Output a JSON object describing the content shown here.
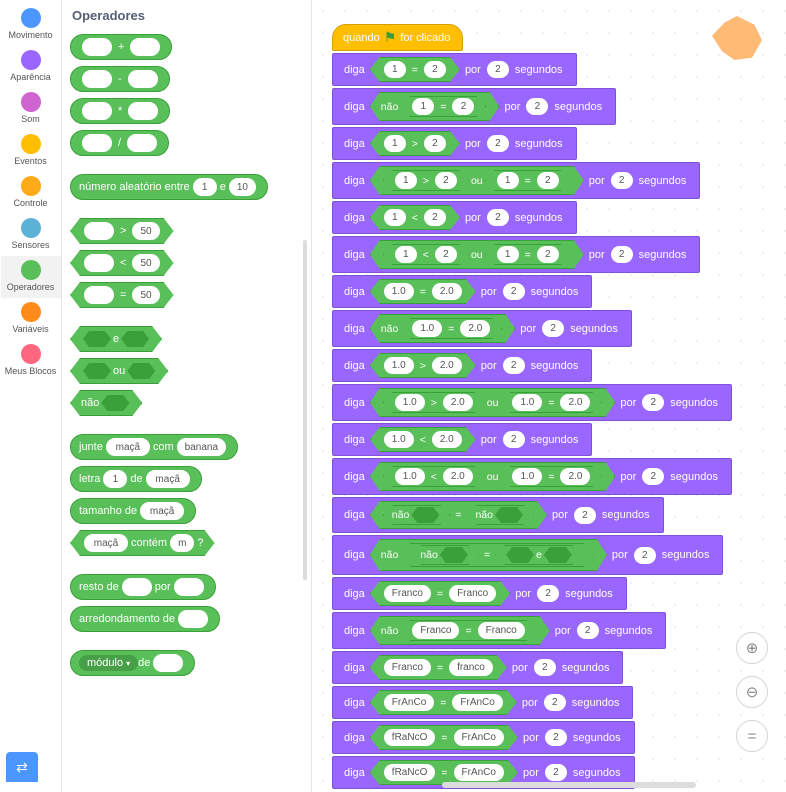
{
  "categories": [
    {
      "name": "Movimento",
      "color": "#4c97ff"
    },
    {
      "name": "Aparência",
      "color": "#9966ff"
    },
    {
      "name": "Som",
      "color": "#cf63cf"
    },
    {
      "name": "Eventos",
      "color": "#ffbf00"
    },
    {
      "name": "Controle",
      "color": "#ffab19"
    },
    {
      "name": "Sensores",
      "color": "#5cb1d6"
    },
    {
      "name": "Operadores",
      "color": "#59c059"
    },
    {
      "name": "Variáveis",
      "color": "#ff8c1a"
    },
    {
      "name": "Meus Blocos",
      "color": "#ff6680"
    }
  ],
  "selected_category": "Operadores",
  "palette": {
    "title": "Operadores",
    "arith": [
      "+",
      "-",
      "*",
      "/"
    ],
    "random": {
      "label_pre": "número aleatório entre",
      "a": "1",
      "mid": "e",
      "b": "10"
    },
    "compare": [
      {
        "op": ">",
        "rhs": "50"
      },
      {
        "op": "<",
        "rhs": "50"
      },
      {
        "op": "=",
        "rhs": "50"
      }
    ],
    "logic": [
      {
        "label": "e",
        "slots": 2
      },
      {
        "label": "ou",
        "slots": 2
      },
      {
        "label": "não",
        "slots": 1
      }
    ],
    "strings": {
      "join": {
        "label_pre": "junte",
        "a": "maçã",
        "mid": "com",
        "b": "banana"
      },
      "letter": {
        "label_pre": "letra",
        "idx": "1",
        "mid": "de",
        "str": "maçã"
      },
      "length": {
        "label": "tamanho de",
        "str": "maçã"
      },
      "contains": {
        "str": "maçã",
        "label": "contém",
        "sub": "m",
        "suffix": "?"
      }
    },
    "math": {
      "mod": {
        "label_pre": "resto de",
        "mid": "por"
      },
      "round": {
        "label": "arredondamento de"
      },
      "mathop": {
        "op": "módulo",
        "mid": "de"
      }
    }
  },
  "script": {
    "hat": {
      "pre": "quando",
      "post": "for clicado"
    },
    "say_word": "diga",
    "for_word": "por",
    "sec_word": "segundos",
    "secs": "2",
    "or_word": "ou",
    "and_word": "e",
    "not_word": "não",
    "rows": [
      {
        "t": "cmp",
        "a": "1",
        "op": "=",
        "b": "2"
      },
      {
        "t": "not_cmp",
        "a": "1",
        "op": "=",
        "b": "2"
      },
      {
        "t": "cmp",
        "a": "1",
        "op": ">",
        "b": "2"
      },
      {
        "t": "or_cmp",
        "a1": "1",
        "op1": ">",
        "b1": "2",
        "a2": "1",
        "op2": "=",
        "b2": "2"
      },
      {
        "t": "cmp",
        "a": "1",
        "op": "<",
        "b": "2"
      },
      {
        "t": "or_cmp",
        "a1": "1",
        "op1": "<",
        "b1": "2",
        "a2": "1",
        "op2": "=",
        "b2": "2"
      },
      {
        "t": "cmp",
        "a": "1.0",
        "op": "=",
        "b": "2.0"
      },
      {
        "t": "not_cmp",
        "a": "1.0",
        "op": "=",
        "b": "2.0"
      },
      {
        "t": "cmp",
        "a": "1.0",
        "op": ">",
        "b": "2.0"
      },
      {
        "t": "or_cmp",
        "a1": "1.0",
        "op1": ">",
        "b1": "2.0",
        "a2": "1.0",
        "op2": "=",
        "b2": "2.0"
      },
      {
        "t": "cmp",
        "a": "1.0",
        "op": "<",
        "b": "2.0"
      },
      {
        "t": "or_cmp",
        "a1": "1.0",
        "op1": "<",
        "b1": "2.0",
        "a2": "1.0",
        "op2": "=",
        "b2": "2.0"
      },
      {
        "t": "eq_not_not"
      },
      {
        "t": "not_not_eq_and"
      },
      {
        "t": "cmp",
        "a": "Franco",
        "op": "=",
        "b": "Franco"
      },
      {
        "t": "not_cmp",
        "a": "Franco",
        "op": "=",
        "b": "Franco"
      },
      {
        "t": "cmp",
        "a": "Franco",
        "op": "=",
        "b": "franco"
      },
      {
        "t": "cmp",
        "a": "FrAnCo",
        "op": "=",
        "b": "FrAnCo"
      },
      {
        "t": "cmp",
        "a": "fRaNcO",
        "op": "=",
        "b": "FrAnCo"
      },
      {
        "t": "cmp",
        "a": "fRaNcO",
        "op": "=",
        "b": "FrAnCo"
      }
    ]
  },
  "zoom": {
    "in": "⊕",
    "out": "⊖",
    "eq": "="
  }
}
